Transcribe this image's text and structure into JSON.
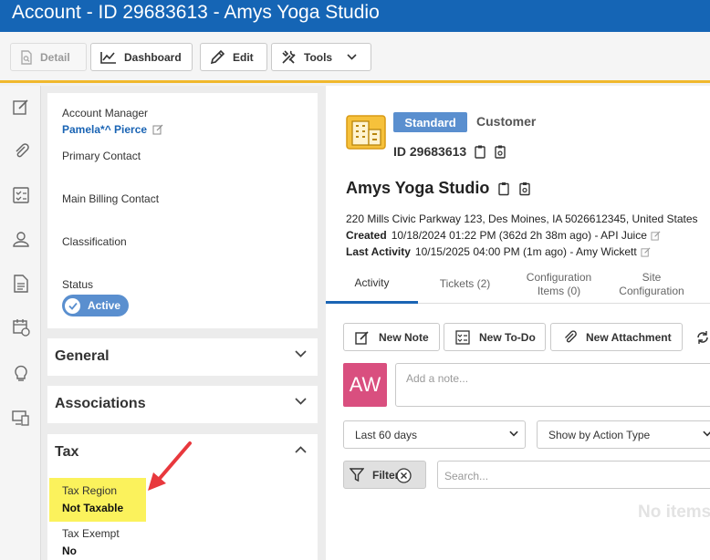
{
  "window": {
    "title": "Account - ID 29683613 - Amys Yoga Studio"
  },
  "toolbar": {
    "detail": "Detail",
    "dashboard": "Dashboard",
    "edit": "Edit",
    "tools": "Tools"
  },
  "left": {
    "account_manager_label": "Account Manager",
    "account_manager_value": "Pamela*^ Pierce",
    "primary_contact_label": "Primary Contact",
    "main_billing_label": "Main Billing Contact",
    "classification_label": "Classification",
    "status_label": "Status",
    "status_value": "Active",
    "sections": {
      "general": "General",
      "associations": "Associations",
      "tax": "Tax"
    },
    "tax_region_label": "Tax Region",
    "tax_region_value": "Not Taxable",
    "tax_exempt_label": "Tax Exempt",
    "tax_exempt_value": "No"
  },
  "account": {
    "type_badge": "Standard",
    "type_label": "Customer",
    "id": "ID 29683613",
    "name": "Amys Yoga Studio",
    "address": "220 Mills Civic Parkway 123, Des Moines, IA 5026612345, United States",
    "created_label": "Created",
    "created_value": "10/18/2024 01:22 PM (362d 2h 38m ago) - API Juice",
    "last_activity_label": "Last Activity",
    "last_activity_value": "10/15/2025 04:00 PM (1m ago) - Amy Wickett"
  },
  "tabs": {
    "activity": "Activity",
    "tickets": "Tickets (2)",
    "config_items_1": "Configuration",
    "config_items_2": "Items (0)",
    "site_config_1": "Site",
    "site_config_2": "Configuration"
  },
  "actions": {
    "new_note": "New Note",
    "new_todo": "New To-Do",
    "new_attachment": "New Attachment"
  },
  "note": {
    "avatar_initials": "AW",
    "placeholder": "Add a note..."
  },
  "filters": {
    "date_range": "Last 60 days",
    "grouping": "Show by Action Type",
    "filter_button": "Filter",
    "search_placeholder": "Search...",
    "empty_message": "No items"
  },
  "colors": {
    "header_blue": "#1565b5",
    "accent_yellow": "#f0b82d",
    "pill_blue": "#5a8fcf",
    "avatar_pink": "#d94f7f",
    "highlight": "#fbf25c",
    "arrow_red": "#e8383d"
  }
}
